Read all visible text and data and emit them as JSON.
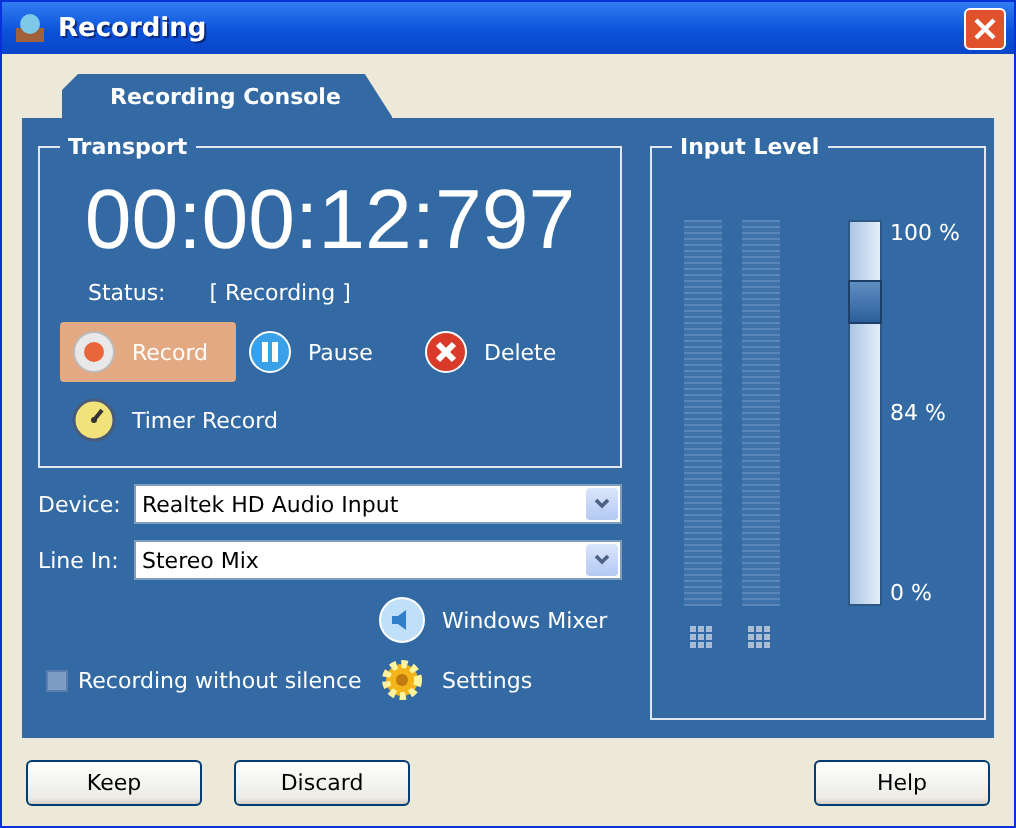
{
  "window": {
    "title": "Recording"
  },
  "tabs": [
    {
      "label": "Recording Console",
      "selected": true
    }
  ],
  "transport": {
    "title": "Transport",
    "time": "00:00:12:797",
    "status_label": "Status:",
    "status_value": "[ Recording ]",
    "buttons": [
      {
        "kind": "record",
        "label": "Record",
        "active": true
      },
      {
        "kind": "pause",
        "label": "Pause",
        "active": false
      },
      {
        "kind": "delete",
        "label": "Delete",
        "active": false
      },
      {
        "kind": "timer",
        "label": "Timer Record",
        "active": false
      }
    ]
  },
  "fields": [
    {
      "label": "Device:",
      "value": "Realtek HD Audio Input"
    },
    {
      "label": "Line In:",
      "value": "Stereo Mix"
    }
  ],
  "windows_mixer": "Windows Mixer",
  "settings": "Settings",
  "silence_option": {
    "label": "Recording without silence",
    "checked": false
  },
  "input_level": {
    "title": "Input Level",
    "level": 0.83,
    "marks": [
      "100 %",
      "84 %",
      "0 %"
    ]
  },
  "footer_buttons": [
    "Keep",
    "Discard",
    "Help"
  ]
}
